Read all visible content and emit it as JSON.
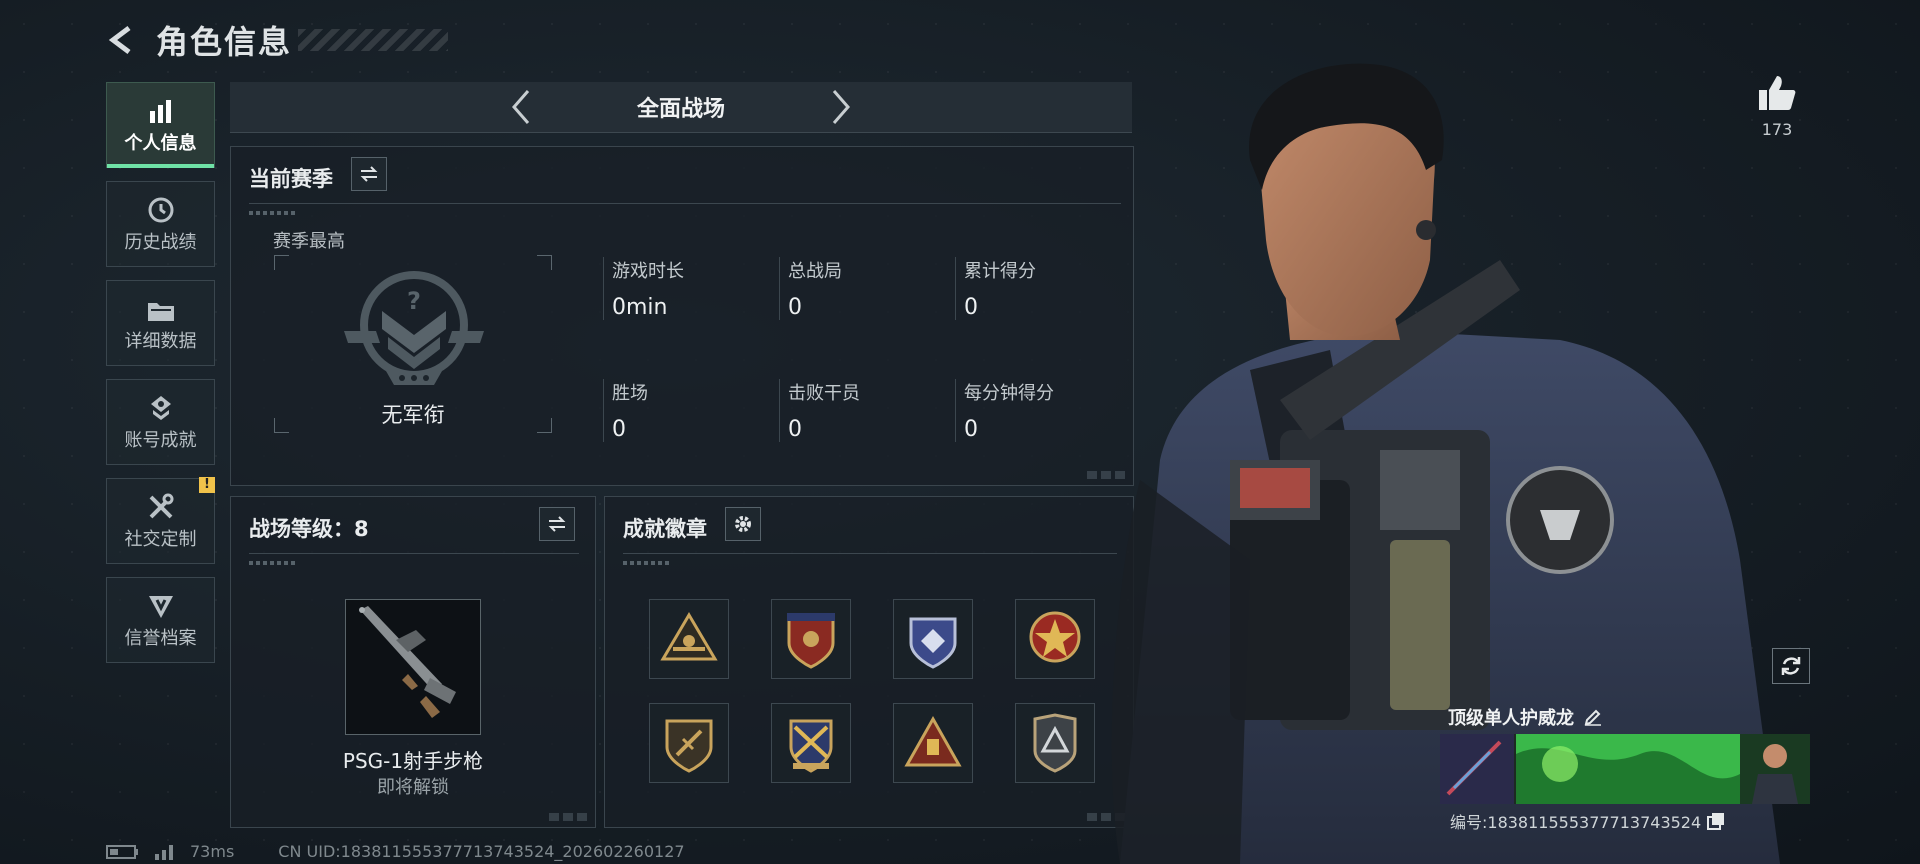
{
  "header": {
    "title": "角色信息"
  },
  "nav": [
    {
      "label": "个人信息",
      "icon": "bar-chart-icon",
      "active": true
    },
    {
      "label": "历史战绩",
      "icon": "history-icon"
    },
    {
      "label": "详细数据",
      "icon": "folder-icon"
    },
    {
      "label": "账号成就",
      "icon": "achievement-icon"
    },
    {
      "label": "社交定制",
      "icon": "tools-icon",
      "badge": "!"
    },
    {
      "label": "信誉档案",
      "icon": "reputation-icon"
    }
  ],
  "mode": {
    "title": "全面战场"
  },
  "season": {
    "title": "当前赛季",
    "best_label": "赛季最高",
    "rank_name": "无军衔",
    "stats": [
      {
        "label": "游戏时长",
        "value": "0min"
      },
      {
        "label": "总战局",
        "value": "0"
      },
      {
        "label": "累计得分",
        "value": "0"
      },
      {
        "label": "胜场",
        "value": "0"
      },
      {
        "label": "击败干员",
        "value": "0"
      },
      {
        "label": "每分钟得分",
        "value": "0"
      }
    ]
  },
  "battle_level": {
    "title": "战场等级：8",
    "weapon_name": "PSG-1射手步枪",
    "weapon_status": "即将解锁"
  },
  "badges": {
    "title": "成就徽章",
    "count": 8
  },
  "profile": {
    "likes": "173",
    "title_card_name": "顶级单人护威龙",
    "player_id": "编号:183811555377713743524"
  },
  "footer": {
    "ping": "73ms",
    "uid": "CN UID:183811555377713743524_202602260127"
  },
  "colors": {
    "accent": "#6fe2a6",
    "warning": "#f0c24a",
    "medal_gold": "#c9a45c"
  }
}
